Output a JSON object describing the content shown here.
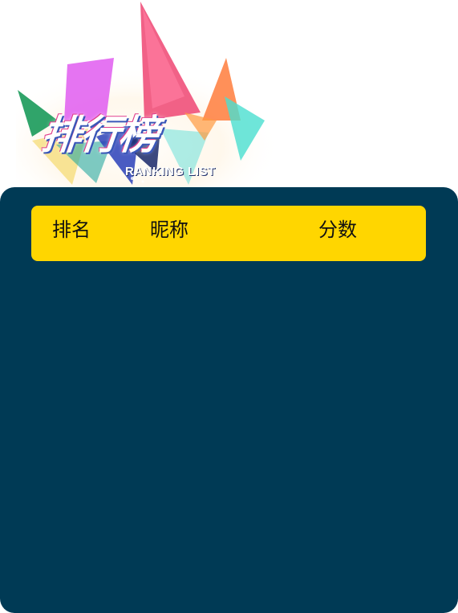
{
  "banner": {
    "title": "排行榜",
    "subtitle": "RANKING LIST"
  },
  "leaderboard": {
    "columns": {
      "rank": "排名",
      "nickname": "昵称",
      "score": "分数"
    },
    "rows": []
  },
  "colors": {
    "panel_background": "#003a55",
    "header_background": "#ffd600",
    "header_text": "#111111"
  }
}
